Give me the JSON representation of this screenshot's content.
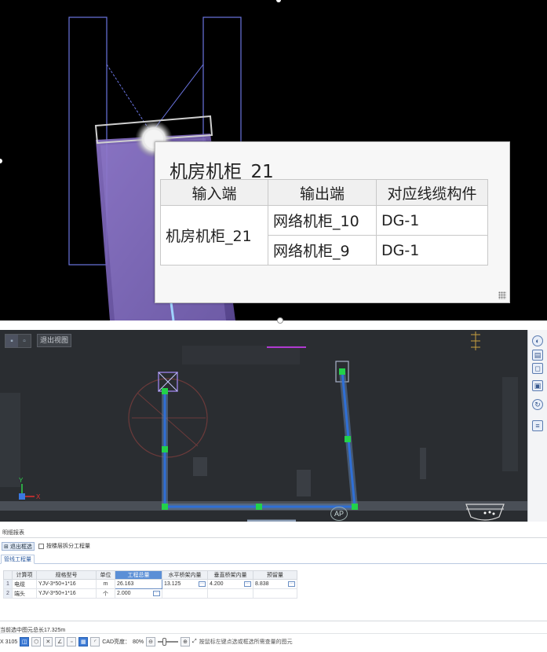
{
  "popup": {
    "title": "机房机柜_21",
    "headers": [
      "输入端",
      "输出端",
      "对应线缆构件"
    ],
    "input": "机房机柜_21",
    "rows": [
      {
        "output": "网络机柜_10",
        "cable": "DG-1"
      },
      {
        "output": "网络机柜_9",
        "cable": "DG-1"
      }
    ]
  },
  "cad": {
    "exit_view_label": "退出视图",
    "ap_label": "AP",
    "axis_x": "X",
    "axis_y": "Y",
    "colors": {
      "background": "#2a2d31",
      "pipe": "#2f6fd6",
      "node": "#23d14a"
    }
  },
  "panel": {
    "title": "明细报表",
    "exit_select_label": "退出框选",
    "split_floor_label": "按楼层拆分工程量",
    "tab_label": "管线工程量",
    "headers": [
      "计算项",
      "规格型号",
      "单位",
      "工程总量",
      "水平桥架内量",
      "垂直桥架内量",
      "预留量"
    ],
    "rows": [
      {
        "index": "1",
        "item": "电缆",
        "spec": "YJV-3*50+1*16",
        "unit": "m",
        "total": "26.163",
        "horizontal": "13.125",
        "vertical": "4.200",
        "reserve": "8.838"
      },
      {
        "index": "2",
        "item": "端头",
        "spec": "YJV-3*50+1*16",
        "unit": "个",
        "total": "2.000",
        "horizontal": "",
        "vertical": "",
        "reserve": ""
      }
    ],
    "status_length": "当前选中图元总长17.325m",
    "toolbar": {
      "coord_prefix": "X",
      "coord_value": "3105",
      "cad_brightness_label": "CAD亮度：",
      "cad_brightness_value": "80%",
      "hint": "按鼠标左键点选或框选所需查量的图元"
    }
  }
}
